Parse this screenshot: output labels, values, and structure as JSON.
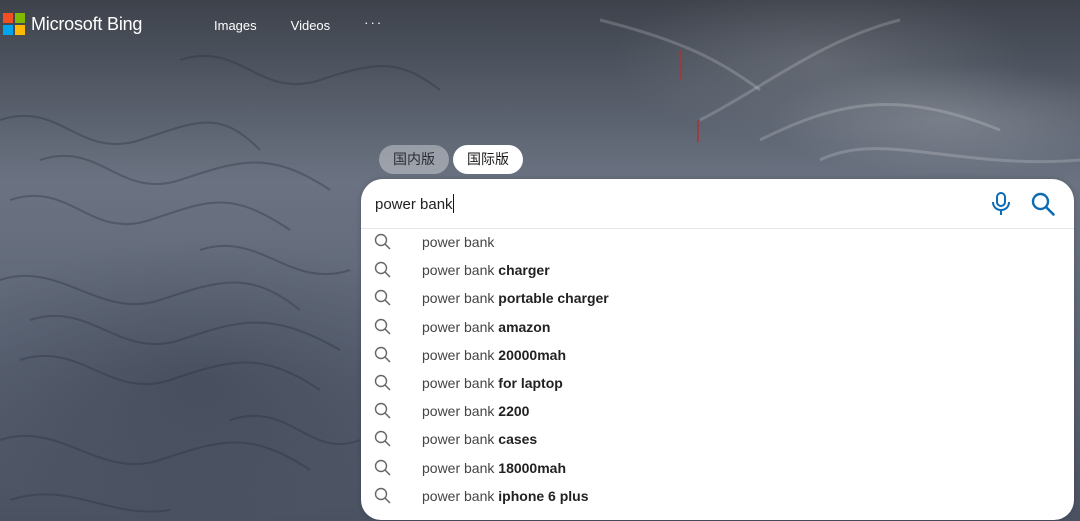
{
  "brand": {
    "name": "Microsoft Bing",
    "colors": [
      "#f25022",
      "#7fba00",
      "#00a4ef",
      "#ffb900"
    ]
  },
  "nav": {
    "items": [
      {
        "label": "Images"
      },
      {
        "label": "Videos"
      }
    ],
    "more_label": "···"
  },
  "market_tabs": [
    {
      "label": "国内版",
      "active": false
    },
    {
      "label": "国际版",
      "active": true
    }
  ],
  "search": {
    "value": "power bank",
    "mic_icon": "microphone-icon",
    "search_icon": "search-icon",
    "accent": "#0c6bb5"
  },
  "suggestions": [
    {
      "prefix": "power bank",
      "completion": ""
    },
    {
      "prefix": "power bank ",
      "completion": "charger"
    },
    {
      "prefix": "power bank ",
      "completion": "portable charger"
    },
    {
      "prefix": "power bank ",
      "completion": "amazon"
    },
    {
      "prefix": "power bank ",
      "completion": "20000mah"
    },
    {
      "prefix": "power bank ",
      "completion": "for laptop"
    },
    {
      "prefix": "power bank ",
      "completion": "2200"
    },
    {
      "prefix": "power bank ",
      "completion": "cases"
    },
    {
      "prefix": "power bank ",
      "completion": "18000mah"
    },
    {
      "prefix": "power bank ",
      "completion": "iphone 6 plus"
    }
  ]
}
